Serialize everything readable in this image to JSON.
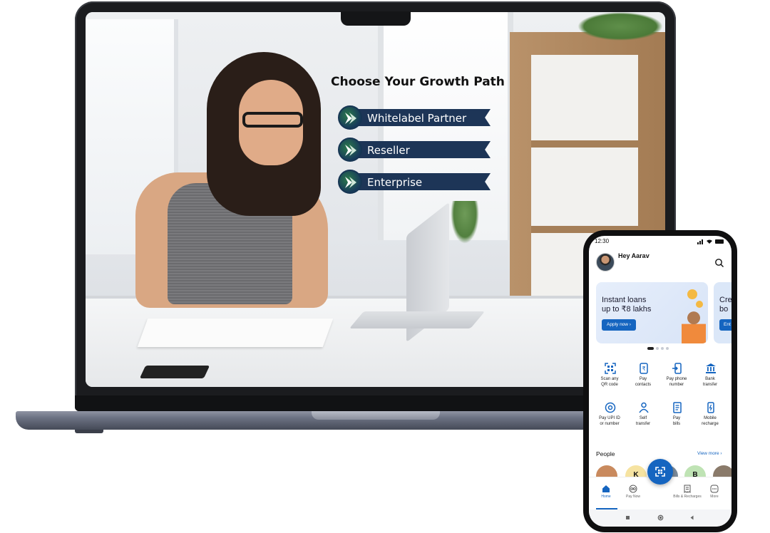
{
  "laptop": {
    "heading": "Choose Your Growth Path",
    "paths": [
      {
        "label": "Whitelabel Partner"
      },
      {
        "label": "Reseller"
      },
      {
        "label": "Enterprise"
      }
    ],
    "colors": {
      "ribbon": "#1d3557",
      "badge_green": "#2b7a4b"
    }
  },
  "phone": {
    "status_time": "12:30",
    "greeting": "Hey Aarav",
    "banner": {
      "title_line1": "Instant loans",
      "title_line2": "up to ₹8 lakhs",
      "cta": "Apply now ›"
    },
    "banner_peek": {
      "title_line1": "Cre",
      "title_line2": "bo",
      "cta": "Ent"
    },
    "carousel": {
      "count": 4,
      "active_index": 0
    },
    "actions": [
      {
        "icon": "qr-scan-icon",
        "line1": "Scan any",
        "line2": "QR code"
      },
      {
        "icon": "contacts-icon",
        "line1": "Pay",
        "line2": "contacts"
      },
      {
        "icon": "phone-pay-icon",
        "line1": "Pay phone",
        "line2": "number"
      },
      {
        "icon": "bank-icon",
        "line1": "Bank",
        "line2": "transfer"
      },
      {
        "icon": "upi-at-icon",
        "line1": "Pay UPI ID",
        "line2": "or number"
      },
      {
        "icon": "self-transfer-icon",
        "line1": "Self",
        "line2": "transfer"
      },
      {
        "icon": "bill-icon",
        "line1": "Pay",
        "line2": "bills"
      },
      {
        "icon": "mobile-recharge-icon",
        "line1": "Mobile",
        "line2": "recharge"
      }
    ],
    "people": {
      "title": "People",
      "view_more": "View more ›",
      "contacts": [
        {
          "letter": "",
          "color": "#c98a5e"
        },
        {
          "letter": "K",
          "color": "#f6e3a1"
        },
        {
          "letter": "",
          "color": "#7b8a99"
        },
        {
          "letter": "B",
          "color": "#bfe3b4"
        },
        {
          "letter": "",
          "color": "#8a7a6a"
        }
      ]
    },
    "bottom_nav": [
      {
        "label": "Home",
        "icon": "home-icon",
        "active": true
      },
      {
        "label": "Pay Now",
        "icon": "pay-now-icon",
        "active": false
      },
      {
        "label": "",
        "icon": "",
        "active": false
      },
      {
        "label": "Bills & Recharges",
        "icon": "bills-icon",
        "active": false
      },
      {
        "label": "More",
        "icon": "more-icon",
        "active": false
      }
    ],
    "accent": "#1565c0"
  }
}
